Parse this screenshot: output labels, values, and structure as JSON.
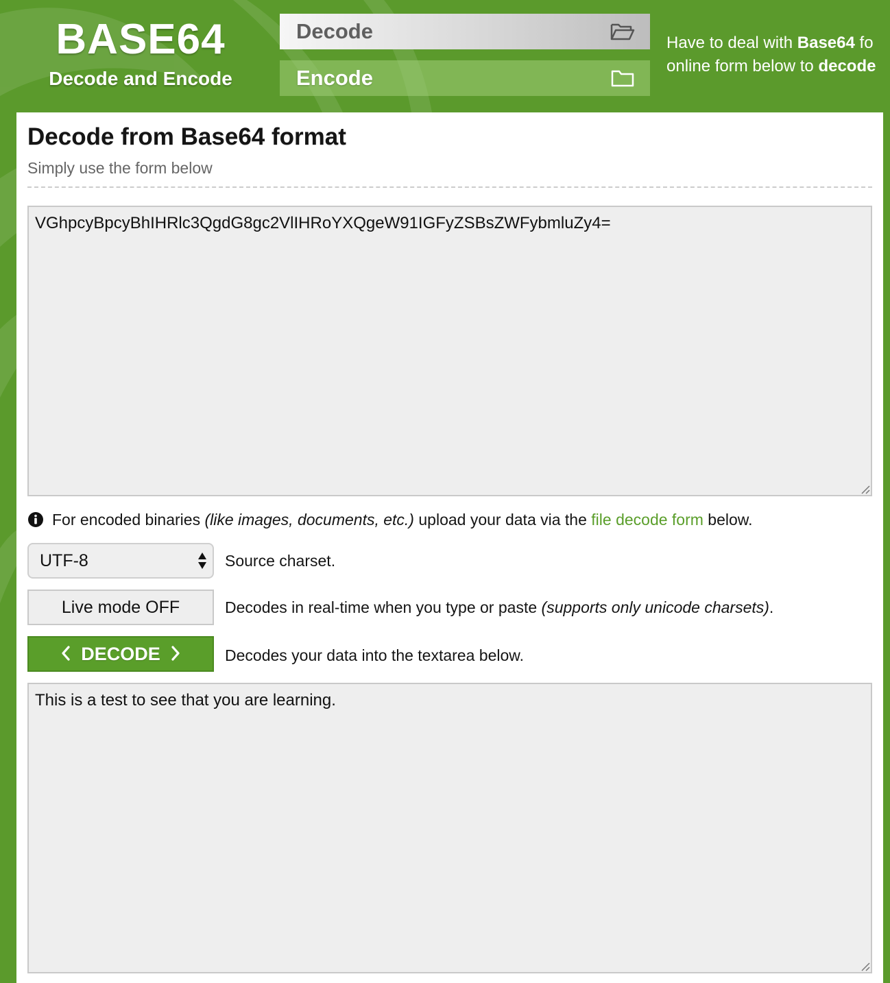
{
  "logo": {
    "title": "BASE64",
    "subtitle": "Decode and Encode"
  },
  "nav": {
    "decode_label": "Decode",
    "encode_label": "Encode",
    "decode_icon": "folder-open-icon",
    "encode_icon": "folder-icon"
  },
  "tagline": {
    "line1_pre": "Have to deal with ",
    "line1_bold": "Base64",
    "line1_post": " fo",
    "line2_pre": "online form below to ",
    "line2_bold": "decode"
  },
  "page": {
    "title": "Decode from Base64 format",
    "subtitle": "Simply use the form below"
  },
  "source_input": {
    "value": "VGhpcyBpcyBhIHRlc3QgdG8gc2VlIHRoYXQgeW91IGFyZSBsZWFybmluZy4="
  },
  "info": {
    "icon": "info-circle-icon",
    "pre": "For encoded binaries ",
    "italic": "(like images, documents, etc.)",
    "mid": " upload your data via the ",
    "link": "file decode form",
    "post": " below."
  },
  "charset": {
    "selected": "UTF-8",
    "description": "Source charset."
  },
  "live_mode": {
    "label": "Live mode OFF",
    "description_pre": "Decodes in real-time when you type or paste ",
    "description_italic": "(supports only unicode charsets)",
    "description_post": "."
  },
  "decode_button": {
    "label": "DECODE",
    "description": "Decodes your data into the textarea below."
  },
  "result_output": {
    "value": "This is a test to see that you are learning."
  },
  "colors": {
    "brand_green": "#5b9a2c",
    "button_green": "#5a9e2a",
    "link_green": "#5a9e2a",
    "textarea_bg": "#eeeeee"
  }
}
